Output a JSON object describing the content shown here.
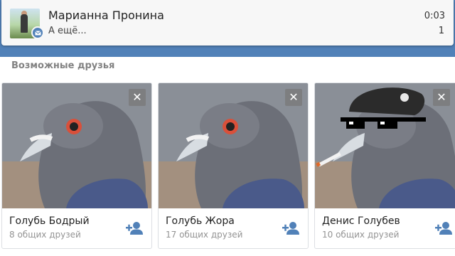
{
  "notification": {
    "name": "Марианна Пронина",
    "text": "А ещё...",
    "time": "0:03",
    "count": "1",
    "badge_icon": "message-icon",
    "accent": "#5181b8"
  },
  "section": {
    "title": "Возможные друзья"
  },
  "friends": [
    {
      "name": "Голубь Бодрый",
      "mutual": "8 общих друзей",
      "remove_icon": "close-icon",
      "add_icon": "add-friend-icon"
    },
    {
      "name": "Голубь Жора",
      "mutual": "17 общих друзей",
      "remove_icon": "close-icon",
      "add_icon": "add-friend-icon"
    },
    {
      "name": "Денис Голубев",
      "mutual": "10 общих друзей",
      "remove_icon": "close-icon",
      "add_icon": "add-friend-icon"
    }
  ]
}
